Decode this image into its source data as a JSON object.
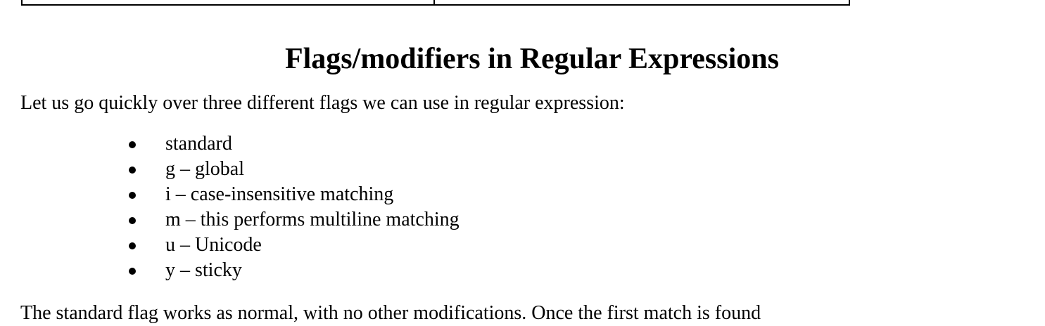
{
  "heading": "Flags/modifiers in Regular Expressions",
  "intro": "Let us go quickly over three different flags we can use in regular expression:",
  "flags": [
    "standard",
    "g – global",
    "i – case-insensitive matching",
    "m – this performs multiline matching",
    "u – Unicode",
    "y – sticky"
  ],
  "next_paragraph_partial": "The standard flag works as normal, with no other modifications. Once the first match is found"
}
